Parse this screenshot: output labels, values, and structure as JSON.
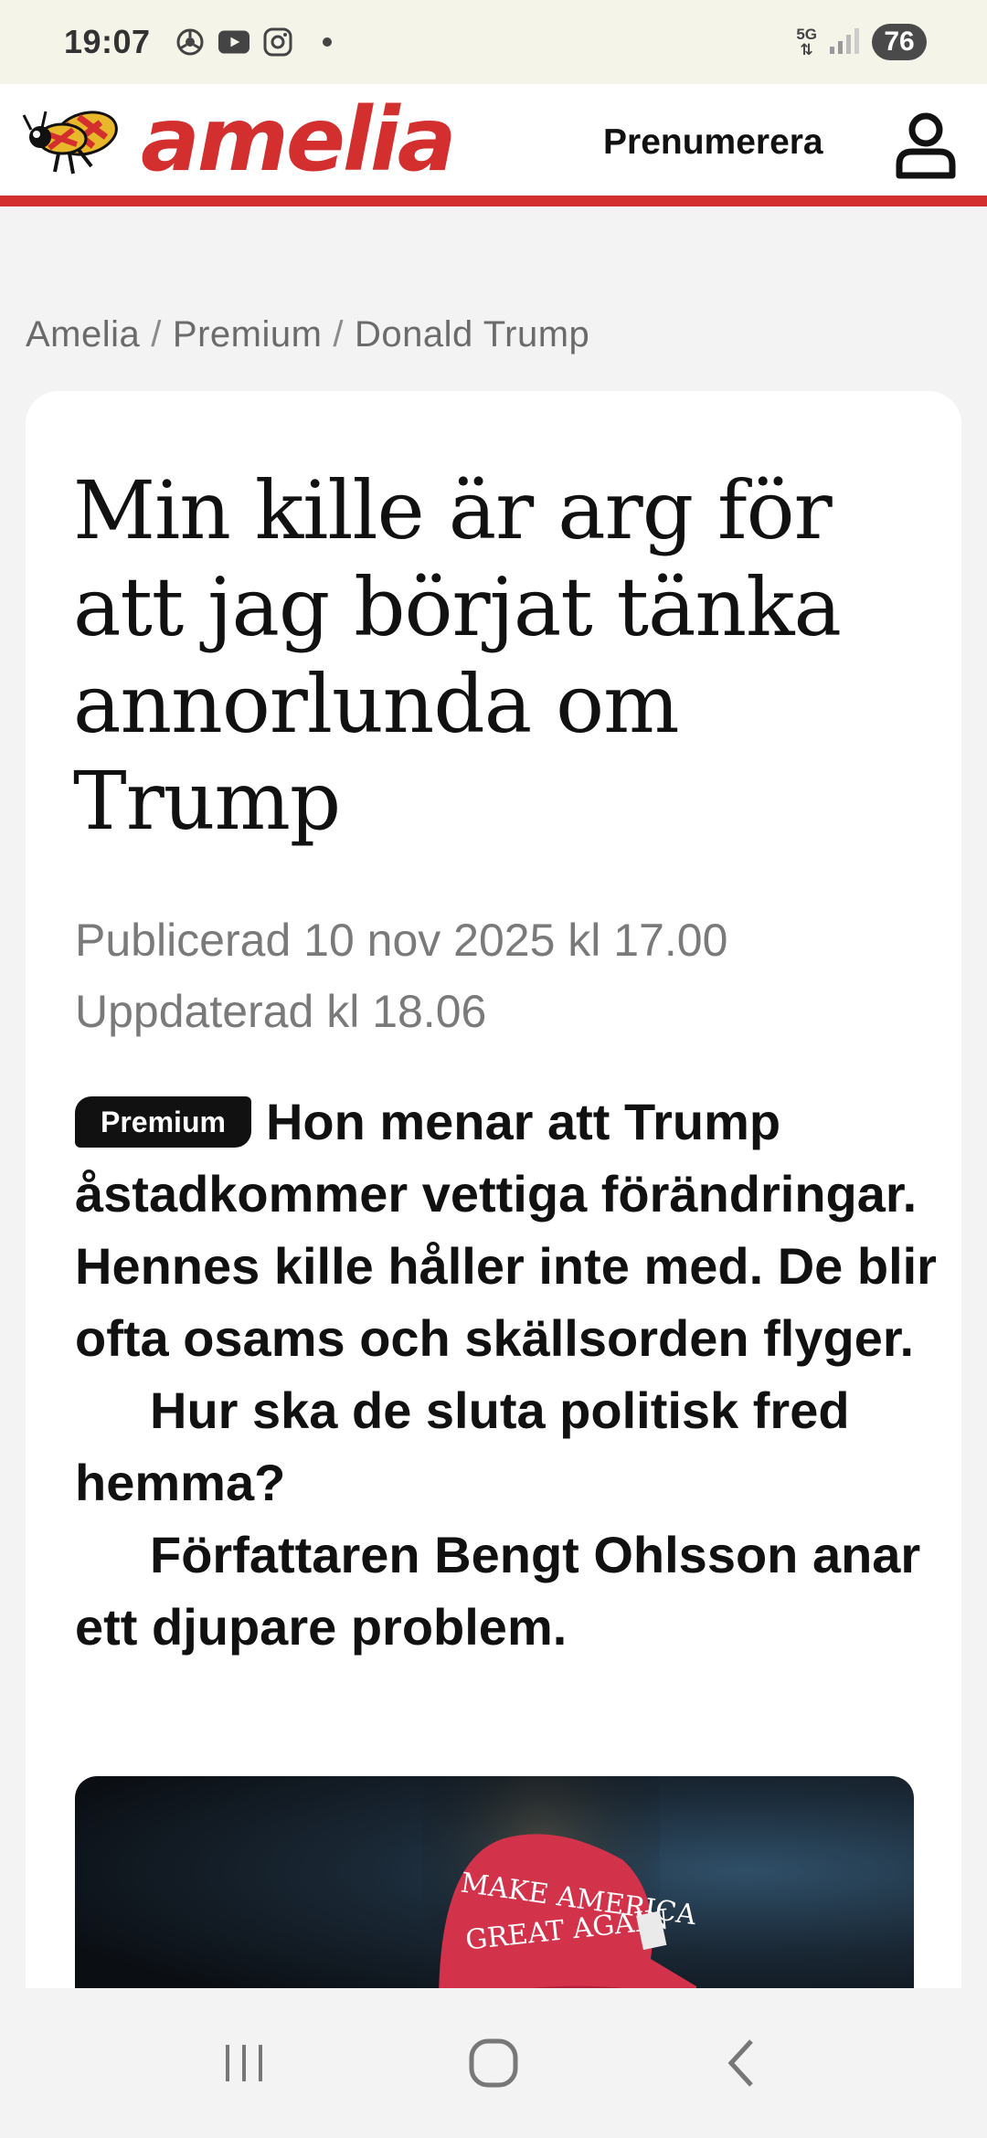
{
  "status_bar": {
    "time": "19:07",
    "network": "5G",
    "battery": "76",
    "icons": [
      "chrome-icon",
      "youtube-icon",
      "instagram-icon",
      "notification-dot"
    ]
  },
  "header": {
    "logo_text": "amelia",
    "subscribe_label": "Prenumerera",
    "brand_color": "#d32f2f"
  },
  "breadcrumb": {
    "items": [
      "Amelia",
      "Premium",
      "Donald Trump"
    ],
    "separator": "/"
  },
  "article": {
    "headline": "Min kille är arg för att jag börjat tänka annorlunda om Trump",
    "published": "Publicerad 10 nov 2025 kl 17.00",
    "updated": "Uppdaterad kl 18.06",
    "badge": "Premium",
    "lead_paragraphs": [
      "Hon menar att Trump åstadkommer vettiga förändringar. Hennes kille håller inte med. De blir ofta osams och skällsorden flyger.",
      "Hur ska de sluta politisk fred hemma?",
      "Författaren Bengt Ohlsson anar ett djupare problem."
    ],
    "hero_cap_text": [
      "MAKE AMERICA",
      "GREAT AGAIN"
    ]
  },
  "navbar": {
    "buttons": [
      "recents-icon",
      "home-icon",
      "back-icon"
    ]
  }
}
